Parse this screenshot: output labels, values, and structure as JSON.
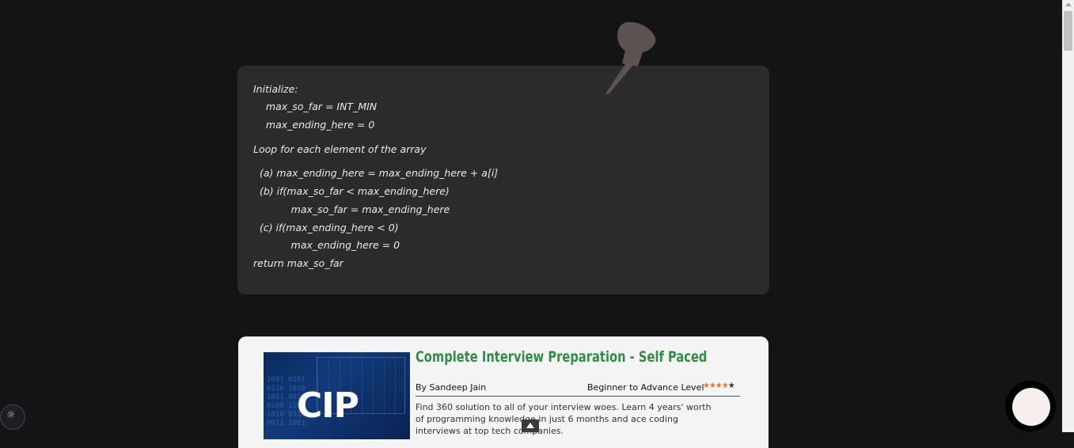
{
  "note": {
    "lines": [
      "Initialize:",
      "    max_so_far = INT_MIN",
      "    max_ending_here = 0",
      "Loop for each element of the array",
      "  (a) max_ending_here = max_ending_here + a[i]",
      "  (b) if(max_so_far < max_ending_here)",
      "            max_so_far = max_ending_here",
      "  (c) if(max_ending_here < 0)",
      "            max_ending_here = 0",
      "return max_so_far"
    ]
  },
  "course": {
    "thumb_text": "CIP",
    "title": "Complete Interview Preparation - Self Paced",
    "author": "By Sandeep Jain",
    "level": "Beginner to Advance Level",
    "rating_stars": 4,
    "description": "Find 360 solution to all of your interview woes. Learn 4 years' worth of programming knowledge in just 6 months and ace coding interviews at top tech companies."
  },
  "colors": {
    "page_bg": "#141417",
    "card_bg": "#2b2b2d",
    "course_title": "#2f8d46",
    "star": "#e87722"
  },
  "icons": {
    "pin": "pushpin-icon",
    "accessibility": "accessibility-icon",
    "scroll_top": "arrow-up-icon",
    "chat": "chat-bubble-icon"
  }
}
